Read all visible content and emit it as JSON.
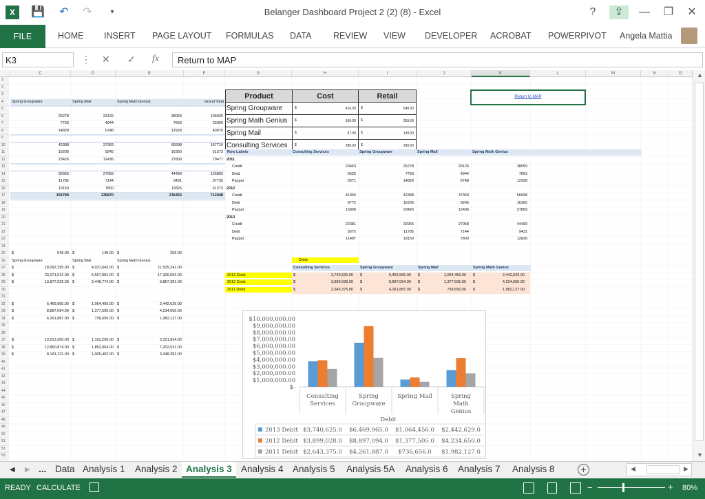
{
  "window": {
    "title": "Belanger Dashboard Project 2 (2) (8) - Excel",
    "help": "?",
    "min": "—",
    "restore": "❐",
    "close": "✕",
    "user": "Angela Mattia"
  },
  "ribbon": {
    "tabs": [
      "FILE",
      "HOME",
      "INSERT",
      "PAGE LAYOUT",
      "FORMULAS",
      "DATA",
      "REVIEW",
      "VIEW",
      "DEVELOPER",
      "ACROBAT",
      "POWERPIVOT"
    ]
  },
  "formula": {
    "cell": "K3",
    "value": "Return to MAP"
  },
  "cols": [
    "C",
    "D",
    "E",
    "F",
    "G",
    "H",
    "I",
    "J",
    "K",
    "L",
    "M",
    "N",
    "O"
  ],
  "left": {
    "hdr": [
      "Spring Groupware",
      "Spring Mail",
      "Spring Math Genius",
      "Grand Total"
    ],
    "block1": [
      [
        "25278",
        "23126",
        "38059",
        "106925"
      ],
      [
        "7763",
        "4944",
        "7653",
        "26365"
      ],
      [
        "14829",
        "6748",
        "12928",
        "43976"
      ]
    ],
    "block2": [
      [
        "42388",
        "37369",
        "66698",
        "167710"
      ],
      [
        "16206",
        "9245",
        "16350",
        "51573"
      ],
      [
        "23426",
        "12436",
        "27809",
        "79477"
      ]
    ],
    "block3": [
      [
        "32955",
        "27058",
        "44499",
        "126893"
      ],
      [
        "11785",
        "7144",
        "9431",
        "37735"
      ],
      [
        "19150",
        "7800",
        "12826",
        "51273"
      ]
    ],
    "totals": [
      "193780",
      "135870",
      "236453",
      "712448"
    ],
    "prices": [
      "549.00",
      "149.00",
      "259.00"
    ],
    "phdr": [
      "Spring Groupware",
      "Spring Mail",
      "Spring Math Genius"
    ],
    "b4": [
      [
        "18,092,295.00",
        "4,031,642.00",
        "11,525,241.00"
      ],
      [
        "23,271,012.00",
        "5,567,981.00",
        "17,326,592.00"
      ],
      [
        "13,877,622.00",
        "3,445,774.00",
        "9,857,281.00"
      ]
    ],
    "b5": [
      [
        "6,469,965.00",
        "1,064,456.00",
        "2,442,629.00"
      ],
      [
        "8,897,094.00",
        "1,377,505.00",
        "4,234,650.00"
      ],
      [
        "4,261,887.00",
        "736,656.00",
        "1,982,127.00"
      ]
    ],
    "b6": [
      [
        "10,513,350.00",
        "1,162,200.00",
        "3,321,934.00"
      ],
      [
        "12,860,874.00",
        "1,852,964.00",
        "7,202,531.00"
      ],
      [
        "8,141,121.00",
        "1,005,452.00",
        "3,348,352.00"
      ]
    ]
  },
  "price_table": {
    "headers": [
      "Product",
      "Cost",
      "Retail"
    ],
    "rows": [
      [
        "Spring Groupware",
        "416.00",
        "549.00"
      ],
      [
        "Spring Math Genius",
        "166.00",
        "259.00"
      ],
      [
        "Spring Mail",
        "97.00",
        "149.00"
      ],
      [
        "Consulting Services",
        "288.00",
        "399.00"
      ]
    ]
  },
  "return_link": "Return to MAP",
  "pivot": {
    "header": [
      "Row Labels",
      "Consulting Services",
      "Spring Groupware",
      "Spring Mail",
      "Spring Math Genius"
    ],
    "years": [
      {
        "year": "2011",
        "rows": [
          [
            "Credit",
            "20463",
            "25278",
            "23126",
            "38059"
          ],
          [
            "Debt",
            "6625",
            "7763",
            "4944",
            "7653"
          ],
          [
            "Paypal",
            "9371",
            "14829",
            "6748",
            "12928"
          ]
        ]
      },
      {
        "year": "2012",
        "rows": [
          [
            "Credit",
            "41055",
            "42388",
            "37369",
            "66698"
          ],
          [
            "Debt",
            "9772",
            "16206",
            "9245",
            "16350"
          ],
          [
            "Paypal",
            "15806",
            "23426",
            "12436",
            "27809"
          ]
        ]
      },
      {
        "year": "2013",
        "rows": [
          [
            "Credit",
            "22381",
            "32955",
            "27058",
            "44499"
          ],
          [
            "Debt",
            "9375",
            "11785",
            "7144",
            "9431"
          ],
          [
            "Paypal",
            "11497",
            "19150",
            "7800",
            "12826"
          ]
        ]
      }
    ]
  },
  "debit": {
    "label": "Debit",
    "header": [
      "Consulting Services",
      "Spring Groupware",
      "Spring Mail",
      "Spring Math Genius"
    ],
    "rows": [
      [
        "2013 Debit",
        "3,740,625.00",
        "6,469,965.00",
        "1,064,456.00",
        "2,442,629.00"
      ],
      [
        "2012 Debit",
        "3,899,028.00",
        "8,897,094.00",
        "1,377,505.00",
        "4,234,650.00"
      ],
      [
        "2011 Debit",
        "2,643,375.00",
        "4,261,887.00",
        "736,656.00",
        "1,982,127.00"
      ]
    ]
  },
  "chart_data": {
    "type": "bar",
    "categories": [
      "Consulting Services",
      "Spring Groupware",
      "Spring Mail",
      "Spring Math Genius"
    ],
    "series": [
      {
        "name": "2013 Debit",
        "color": "#5b9bd5",
        "values": [
          3740625,
          6469965,
          1064456,
          2442629
        ]
      },
      {
        "name": "2012 Debit",
        "color": "#ed7d31",
        "values": [
          3899028,
          8897094,
          1377505,
          4234650
        ]
      },
      {
        "name": "2011 Debit",
        "color": "#a5a5a5",
        "values": [
          2643375,
          4261887,
          736656,
          1982127
        ]
      }
    ],
    "ylim": [
      0,
      10000000
    ],
    "xlabel": "Debit",
    "yticks": [
      "$10,000,000.00",
      "$9,000,000.00",
      "$8,000,000.00",
      "$7,000,000.00",
      "$6,000,000.00",
      "$5,000,000.00",
      "$4,000,000.00",
      "$3,000,000.00",
      "$2,000,000.00",
      "$1,000,000.00",
      "$-"
    ],
    "cat_lines": [
      [
        "Consulting",
        "Services"
      ],
      [
        "Spring",
        "Groupware"
      ],
      [
        "Spring Mail"
      ],
      [
        "Spring",
        "Math",
        "Genius"
      ]
    ],
    "table": [
      [
        "$3,740,625.0",
        "$6,469,965.0",
        "$1,064,456.0",
        "$2,442,629.0"
      ],
      [
        "$3,899,028.0",
        "$8,897,094.0",
        "$1,377,505.0",
        "$4,234,650.0"
      ],
      [
        "$2,643,375.0",
        "$4,261,887.0",
        "$736,656.0",
        "$1,982,127.0"
      ]
    ]
  },
  "sheets": [
    "Data",
    "Analysis 1",
    "Analysis 2",
    "Analysis 3",
    "Analysis 4",
    "Analysis 5",
    "Analysis 5A",
    "Analysis 6",
    "Analysis 7",
    "Analysis 8"
  ],
  "active_sheet": "Analysis 3",
  "status": {
    "ready": "READY",
    "calc": "CALCULATE",
    "zoom": "80%"
  }
}
